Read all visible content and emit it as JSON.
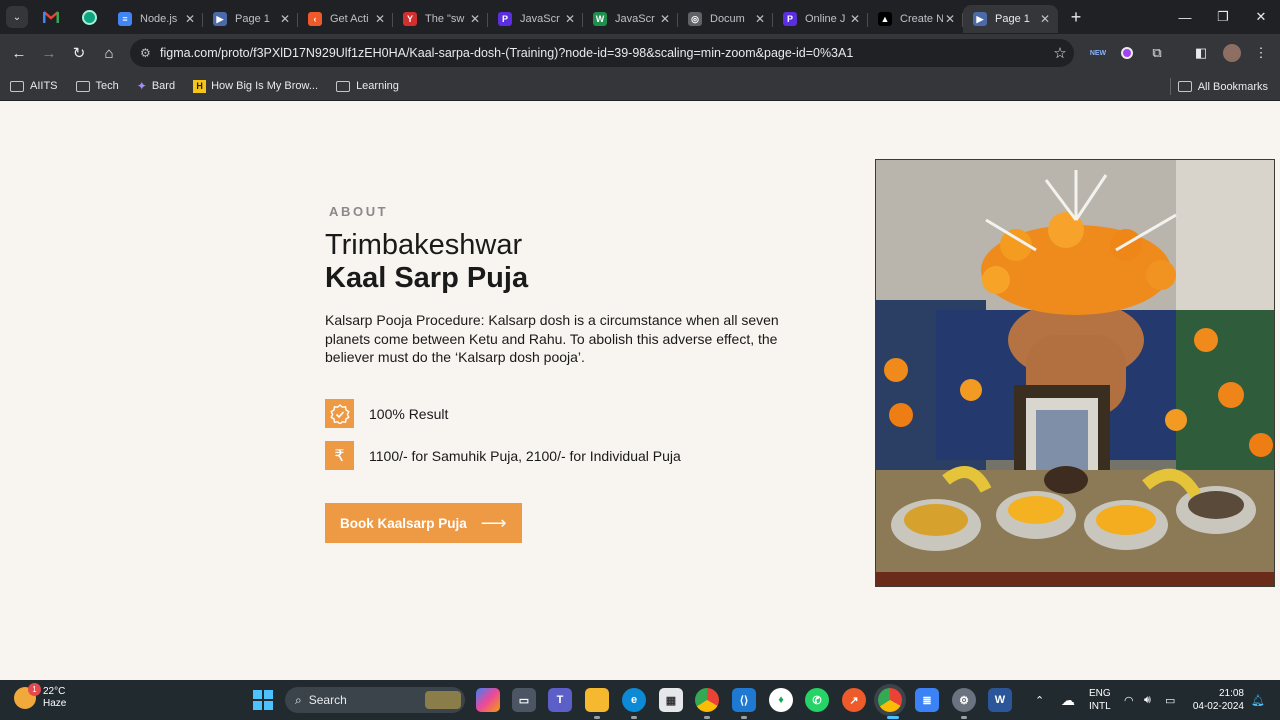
{
  "browser": {
    "tabs": [
      {
        "title": "Node.js",
        "favicon_color": "#4285f4",
        "favicon_glyph": "≡"
      },
      {
        "title": "Page 1",
        "favicon_color": "#4d6aa8",
        "favicon_glyph": "▶"
      },
      {
        "title": "Get Acti",
        "favicon_color": "#ef5a2a",
        "favicon_glyph": "‹"
      },
      {
        "title": "The \"sw",
        "favicon_color": "#d32f2f",
        "favicon_glyph": "Y"
      },
      {
        "title": "JavaScr",
        "favicon_color": "#5b2ee0",
        "favicon_glyph": "P"
      },
      {
        "title": "JavaScr",
        "favicon_color": "#1f8f4e",
        "favicon_glyph": "W"
      },
      {
        "title": "Docum",
        "favicon_color": "#5f6368",
        "favicon_glyph": "◎"
      },
      {
        "title": "Online J",
        "favicon_color": "#5b2ee0",
        "favicon_glyph": "P"
      },
      {
        "title": "Create N",
        "favicon_color": "#000000",
        "favicon_glyph": "▲"
      },
      {
        "title": "Page 1",
        "favicon_color": "#4d6aa8",
        "favicon_glyph": "▶",
        "active": true
      }
    ],
    "url": "figma.com/proto/f3PXlD17N929Ulf1zEH0HA/Kaal-sarpa-dosh-(Training)?node-id=39-98&scaling=min-zoom&page-id=0%3A1",
    "bookmarks": [
      "AIITS",
      "Tech",
      "Bard",
      "How Big Is My Brow...",
      "Learning"
    ],
    "all_bookmarks": "All Bookmarks"
  },
  "page": {
    "eyebrow": "ABOUT",
    "title_line1": "Trimbakeshwar",
    "title_line2": "Kaal Sarp Puja",
    "description": "Kalsarp Pooja Procedure: Kalsarp dosh is a circumstance when all seven planets come between Ketu and Rahu. To abolish this adverse effect, the believer must do the ‘Kalsarp dosh pooja’.",
    "features": [
      {
        "icon": "badge-check-icon",
        "text": "100% Result"
      },
      {
        "icon": "rupee-icon",
        "text": "1100/- for Samuhik Puja, 2100/- for Individual Puja"
      }
    ],
    "cta_label": "Book Kaalsarp Puja",
    "accent_color": "#ee9a45"
  },
  "taskbar": {
    "temperature": "22°C",
    "condition": "Haze",
    "weather_badge": "1",
    "search_label": "Search",
    "lang_line1": "ENG",
    "lang_line2": "INTL",
    "time": "21:08",
    "date": "04-02-2024"
  }
}
